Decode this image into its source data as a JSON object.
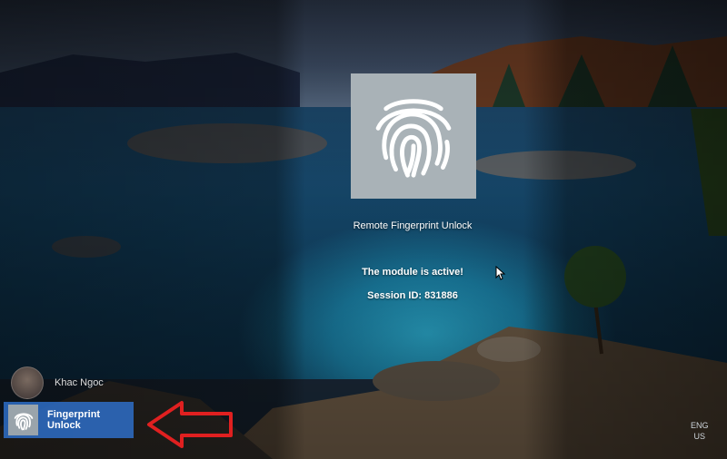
{
  "lock_screen": {
    "app_title": "Remote Fingerprint Unlock",
    "status_text": "The module is active!",
    "session_text": "Session ID: 831886"
  },
  "users": [
    {
      "name": "Khac Ngoc",
      "icon": "avatar"
    },
    {
      "name": "Fingerprint Unlock",
      "icon": "fingerprint-icon",
      "selected": true
    }
  ],
  "language": {
    "line1": "ENG",
    "line2": "US"
  },
  "colors": {
    "tile_bg": "#a9b2b7",
    "selected_account": "#2e6ec8",
    "annotation_arrow": "#e02020"
  }
}
